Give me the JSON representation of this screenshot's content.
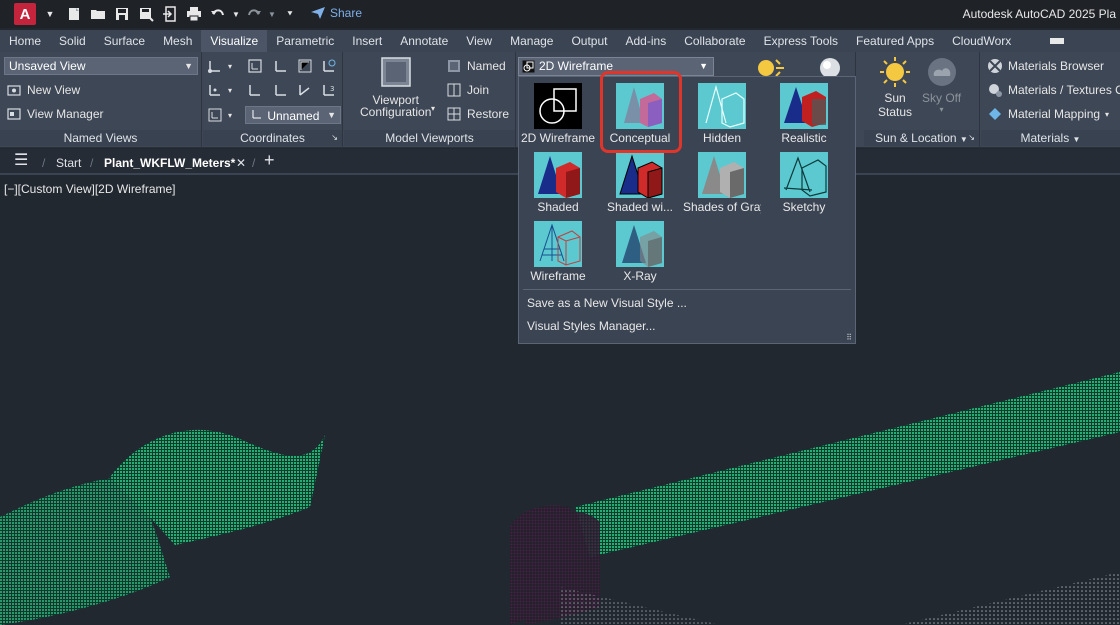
{
  "app": {
    "logo_letter": "A",
    "title": "Autodesk AutoCAD 2025  Pla",
    "share_label": "Share"
  },
  "ribbon_tabs": [
    "Home",
    "Solid",
    "Surface",
    "Mesh",
    "Visualize",
    "Parametric",
    "Insert",
    "Annotate",
    "View",
    "Manage",
    "Output",
    "Add-ins",
    "Collaborate",
    "Express Tools",
    "Featured Apps",
    "CloudWorx"
  ],
  "active_tab": "Visualize",
  "panels": {
    "named_views": {
      "title": "Named Views",
      "combo_value": "Unsaved View",
      "new_view": "New View",
      "view_manager": "View Manager"
    },
    "coordinates": {
      "title": "Coordinates",
      "combo_value": "Unnamed"
    },
    "model_viewports": {
      "title": "Model Viewports",
      "viewport_config_line1": "Viewport",
      "viewport_config_line2": "Configuration",
      "named": "Named",
      "join": "Join",
      "restore": "Restore"
    },
    "sun_location": {
      "title": "Sun & Location",
      "sun_status_line1": "Sun",
      "sun_status_line2": "Status",
      "sky_off": "Sky Off"
    },
    "materials": {
      "title": "Materials",
      "browser": "Materials Browser",
      "textures": "Materials / Textures O",
      "mapping": "Material Mapping"
    }
  },
  "visual_style_combo": "2D Wireframe",
  "visual_styles": [
    {
      "label": "2D Wireframe",
      "icon": "2d-wireframe-icon"
    },
    {
      "label": "Conceptual",
      "icon": "conceptual-icon"
    },
    {
      "label": "Hidden",
      "icon": "hidden-icon"
    },
    {
      "label": "Realistic",
      "icon": "realistic-icon"
    },
    {
      "label": "Shaded",
      "icon": "shaded-icon"
    },
    {
      "label": "Shaded wi...",
      "icon": "shaded-with-edges-icon"
    },
    {
      "label": "Shades of Gray",
      "icon": "shades-of-gray-icon"
    },
    {
      "label": "Sketchy",
      "icon": "sketchy-icon"
    },
    {
      "label": "Wireframe",
      "icon": "wireframe-icon"
    },
    {
      "label": "X-Ray",
      "icon": "x-ray-icon"
    }
  ],
  "visual_styles_menu": {
    "save_new": "Save as a New Visual Style ...",
    "manager": "Visual Styles Manager..."
  },
  "file_tabs": {
    "start": "Start",
    "current": "Plant_WKFLW_Meters*"
  },
  "viewport_label": "[−][Custom View][2D Wireframe]",
  "colors": {
    "highlight": "#e0352b",
    "point_cloud_green": "#2bd58f",
    "point_cloud_purple": "#4a2045",
    "background": "#212830"
  }
}
